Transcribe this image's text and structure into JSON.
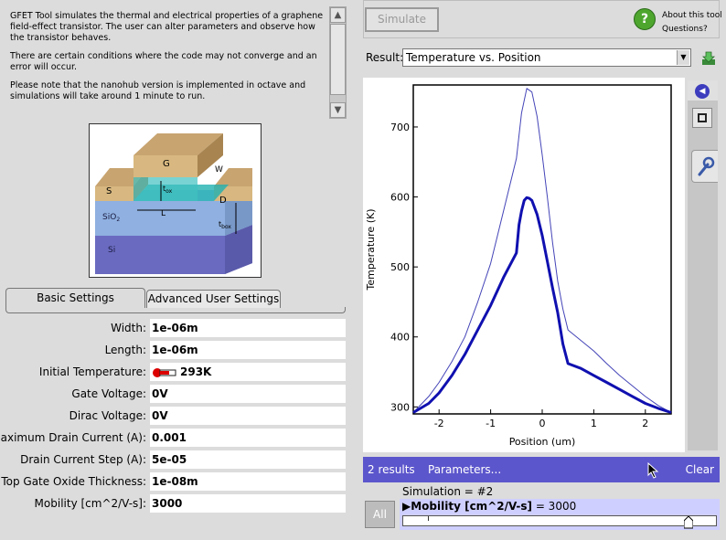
{
  "description": {
    "paragraph1": "GFET Tool simulates the thermal and electrical properties of a graphene field-effect transistor. The user can alter parameters and observe how the transistor behaves.",
    "paragraph2": "There are certain conditions where the code may not converge and an error will occur.",
    "paragraph3": "Please note that the nanohub version is implemented in octave and simulations will take around 1 minute to run."
  },
  "figure": {
    "labels": {
      "gate": "G",
      "source": "S",
      "drain": "D",
      "width": "W",
      "length": "L",
      "tox": "t",
      "tox_sub": "ox",
      "tbox": "t",
      "tbox_sub": "box",
      "sio2": "SiO",
      "sio2_sub": "2",
      "si": "Si"
    }
  },
  "tabs": {
    "basic": "Basic Settings",
    "advanced": "Advanced User Settings"
  },
  "form": [
    {
      "label": "Width:",
      "value": "1e-06m"
    },
    {
      "label": "Length:",
      "value": "1e-06m"
    },
    {
      "label": "Initial Temperature:",
      "value": "293K"
    },
    {
      "label": "Gate Voltage:",
      "value": "0V"
    },
    {
      "label": "Dirac Voltage:",
      "value": "0V"
    },
    {
      "label": "Maximum Drain Current (A):",
      "value": "0.001"
    },
    {
      "label": "Drain Current Step (A):",
      "value": "5e-05"
    },
    {
      "label": "Top Gate Oxide Thickness:",
      "value": "1e-08m"
    },
    {
      "label": "Mobility [cm^2/V-s]:",
      "value": "3000"
    }
  ],
  "toolbar": {
    "simulate": "Simulate",
    "about": "About this tool",
    "questions": "Questions?"
  },
  "result": {
    "label": "Result:",
    "selected": "Temperature vs. Position"
  },
  "colors": {
    "series_thin": "#4444b8",
    "series_thick": "#1010b0",
    "results_bar": "#5c56cc"
  },
  "chart_data": {
    "type": "line",
    "xlabel": "Position (um)",
    "ylabel": "Temperature (K)",
    "xlim": [
      -2.5,
      2.5
    ],
    "ylim": [
      290,
      760
    ],
    "xticks": [
      -2,
      -1,
      0,
      1,
      2
    ],
    "yticks": [
      300,
      400,
      500,
      600,
      700
    ],
    "grid": false,
    "series": [
      {
        "style": "thin",
        "x": [
          -2.5,
          -2.2,
          -2.0,
          -1.75,
          -1.5,
          -1.25,
          -1.0,
          -0.75,
          -0.5,
          -0.4,
          -0.3,
          -0.2,
          -0.1,
          0.0,
          0.1,
          0.2,
          0.3,
          0.4,
          0.5,
          0.75,
          1.0,
          1.25,
          1.5,
          1.75,
          2.0,
          2.25,
          2.5
        ],
        "y": [
          292,
          315,
          335,
          365,
          400,
          450,
          505,
          580,
          655,
          720,
          755,
          750,
          715,
          660,
          600,
          535,
          480,
          440,
          410,
          395,
          380,
          362,
          345,
          330,
          315,
          302,
          292
        ]
      },
      {
        "style": "thick",
        "x": [
          -2.5,
          -2.2,
          -2.0,
          -1.75,
          -1.5,
          -1.25,
          -1.0,
          -0.75,
          -0.5,
          -0.45,
          -0.4,
          -0.35,
          -0.3,
          -0.25,
          -0.2,
          -0.1,
          0.0,
          0.1,
          0.2,
          0.3,
          0.4,
          0.5,
          0.75,
          1.0,
          1.25,
          1.5,
          1.75,
          2.0,
          2.25,
          2.5
        ],
        "y": [
          292,
          305,
          320,
          345,
          375,
          410,
          445,
          485,
          520,
          560,
          580,
          595,
          599,
          598,
          595,
          575,
          545,
          508,
          470,
          435,
          390,
          362,
          355,
          345,
          335,
          325,
          315,
          305,
          298,
          292
        ]
      }
    ]
  },
  "results_bar": {
    "count": "2 results",
    "parameters": "Parameters...",
    "clear": "Clear"
  },
  "simulation": {
    "label": "Simulation = #2",
    "all": "All",
    "param_name": "Mobility [cm^2/V-s]",
    "param_eq": " = 3000",
    "slider_fraction": 0.9
  }
}
